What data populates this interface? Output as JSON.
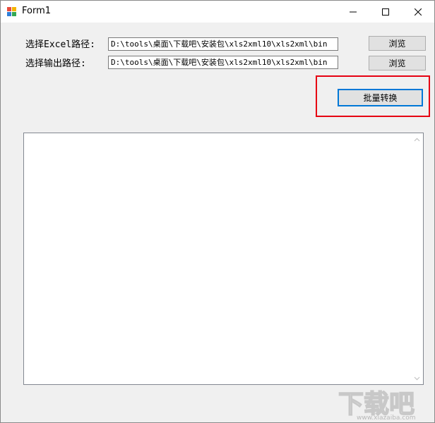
{
  "window": {
    "title": "Form1"
  },
  "form": {
    "excel_path_label": "选择Excel路径:",
    "excel_path_value": "D:\\tools\\桌面\\下载吧\\安装包\\xls2xml10\\xls2xml\\bin",
    "output_path_label": "选择输出路径:",
    "output_path_value": "D:\\tools\\桌面\\下载吧\\安装包\\xls2xml10\\xls2xml\\bin",
    "browse_label_1": "浏览",
    "browse_label_2": "浏览",
    "batch_convert_label": "批量转换"
  },
  "output": {
    "log_text": ""
  },
  "colors": {
    "highlight": "#e60012",
    "focus_border": "#0078d7"
  },
  "watermark": {
    "text": "下载吧",
    "url": "www.xiazaiba.com"
  }
}
